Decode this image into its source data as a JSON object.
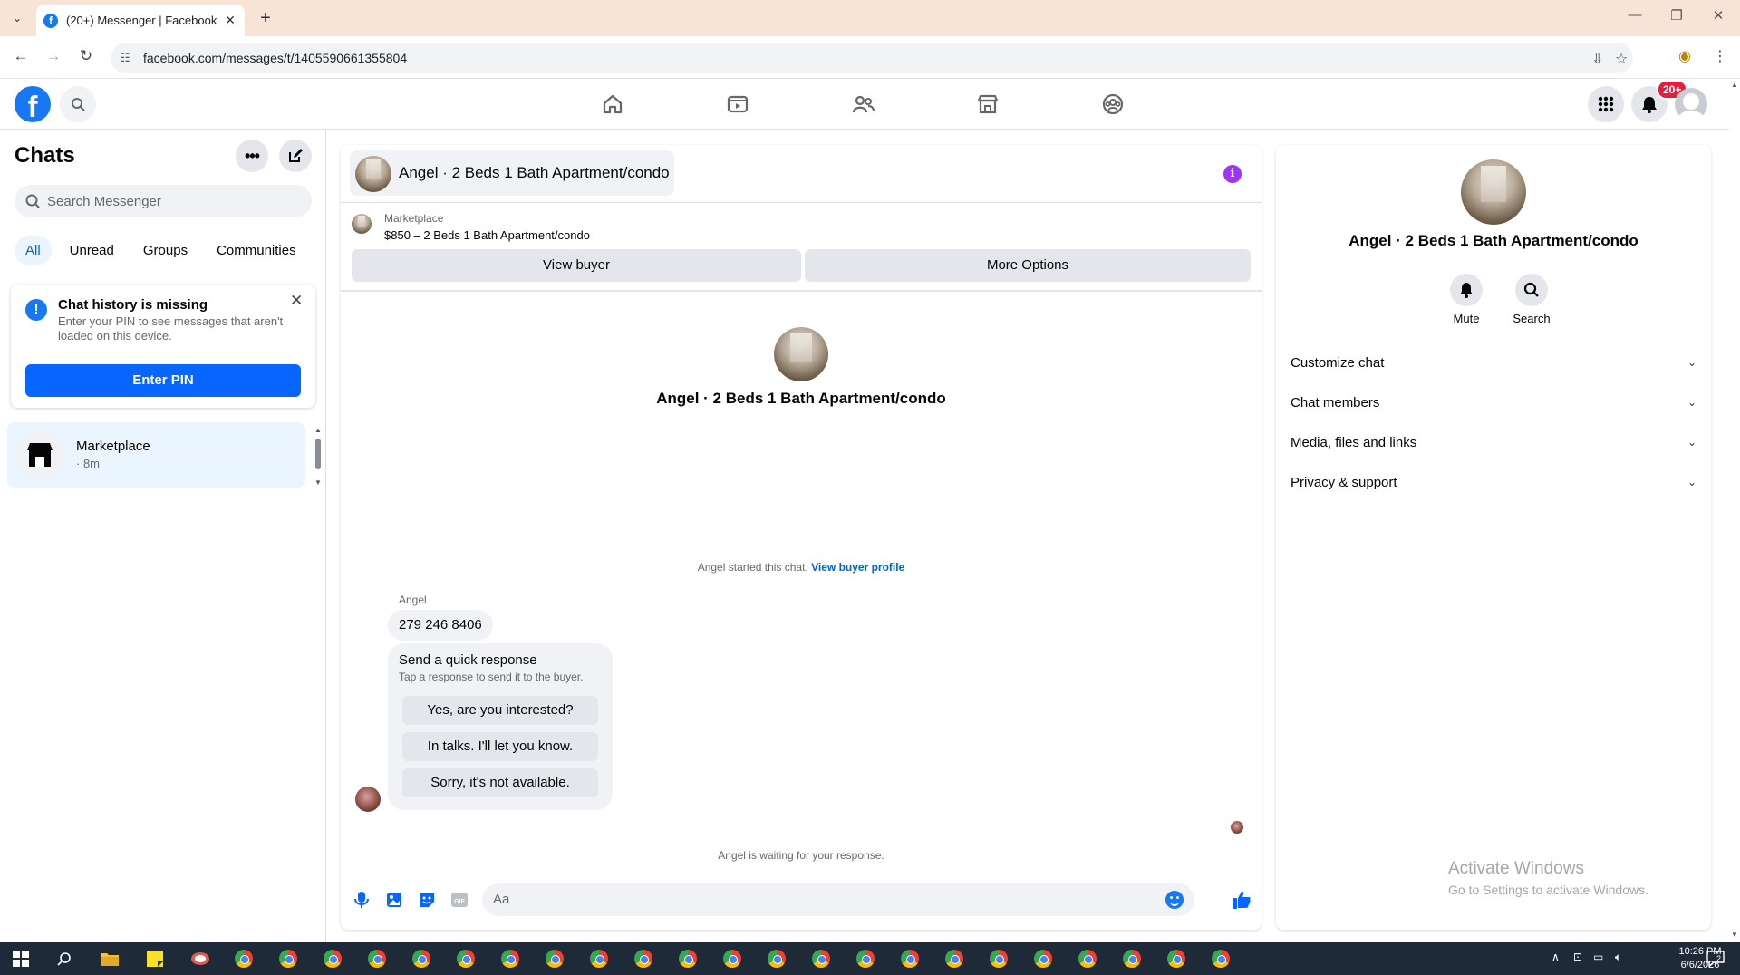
{
  "browser": {
    "tab_title": "(20+) Messenger | Facebook",
    "url": "facebook.com/messages/t/1405590661355804"
  },
  "fb": {
    "notification_badge": "20+"
  },
  "left": {
    "title": "Chats",
    "search_placeholder": "Search Messenger",
    "filters": [
      "All",
      "Unread",
      "Groups",
      "Communities"
    ],
    "pin_card": {
      "title": "Chat history is missing",
      "text": "Enter your PIN to see messages that aren't loaded on this device.",
      "button": "Enter PIN"
    },
    "conversations": [
      {
        "name": "Marketplace",
        "time": "· 8m"
      }
    ]
  },
  "chat": {
    "header_name": "Angel · 2 Beds 1 Bath Apartment/condo",
    "marketplace_label": "Marketplace",
    "listing": "$850 – 2 Beds 1 Bath Apartment/condo",
    "view_buyer": "View buyer",
    "more_options": "More Options",
    "hero_name": "Angel · 2 Beds 1 Bath Apartment/condo",
    "started_text": "Angel started this chat.",
    "started_link": "View buyer profile",
    "sender": "Angel",
    "message": "279 246 8406",
    "quick_title": "Send a quick response",
    "quick_sub": "Tap a response to send it to the buyer.",
    "quick_responses": [
      "Yes, are you interested?",
      "In talks. I'll let you know.",
      "Sorry, it's not available."
    ],
    "waiting": "Angel is waiting for your response.",
    "composer_placeholder": "Aa"
  },
  "details": {
    "name": "Angel · 2 Beds 1 Bath Apartment/condo",
    "actions": [
      "Mute",
      "Search"
    ],
    "sections": [
      "Customize chat",
      "Chat members",
      "Media, files and links",
      "Privacy & support"
    ],
    "watermark_title": "Activate Windows",
    "watermark_sub": "Go to Settings to activate Windows."
  },
  "taskbar": {
    "time": "10:26 PM",
    "date": "6/6/2026",
    "notifications": "2"
  },
  "colors": {
    "accent": "#0866ff",
    "fb_blue": "#1877f2",
    "active_chat_bg": "#ebf5ff",
    "info_purple": "#a033ff",
    "badge_red": "#e41e3f"
  }
}
